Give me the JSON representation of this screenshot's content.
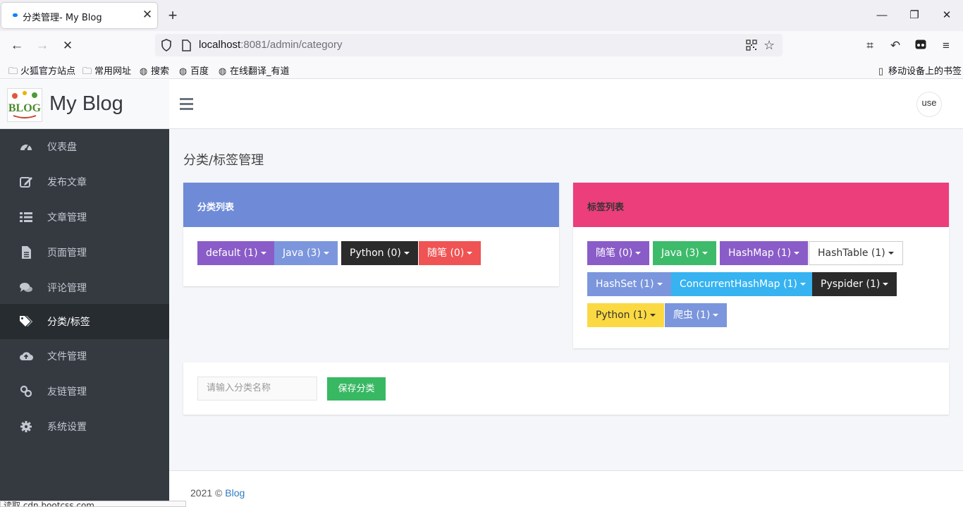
{
  "browser": {
    "tab_title": "分类管理- My Blog",
    "url_host": "localhost",
    "url_rest": ":8081/admin/category",
    "bookmarks": [
      "火狐官方站点",
      "常用网址",
      "搜索",
      "百度",
      "在线翻译_有道"
    ],
    "mobile_bookmarks": "移动设备上的书签",
    "status_text": "读取 cdn.bootcss.com..."
  },
  "brand": {
    "name": "My Blog",
    "logo_text": "BLOG"
  },
  "sidebar": {
    "items": [
      {
        "label": "仪表盘",
        "icon": "dashboard-icon"
      },
      {
        "label": "发布文章",
        "icon": "edit-icon"
      },
      {
        "label": "文章管理",
        "icon": "list-icon"
      },
      {
        "label": "页面管理",
        "icon": "file-icon"
      },
      {
        "label": "评论管理",
        "icon": "comments-icon"
      },
      {
        "label": "分类/标签",
        "icon": "tags-icon",
        "active": true
      },
      {
        "label": "文件管理",
        "icon": "cloud-upload-icon"
      },
      {
        "label": "友链管理",
        "icon": "link-icon"
      },
      {
        "label": "系统设置",
        "icon": "gear-icon"
      }
    ]
  },
  "header": {
    "avatar_text": "use"
  },
  "main": {
    "page_title": "分类/标签管理",
    "categories": {
      "title": "分类列表",
      "header_color": "#6f8bd8",
      "items": [
        {
          "label": "default (1)",
          "color": "#8a5cc8"
        },
        {
          "label": "Java (3)",
          "color": "#7b96dc"
        },
        {
          "label": "Python (0)",
          "color": "#2b2b2b"
        },
        {
          "label": "随笔 (0)",
          "color": "#ef5353"
        }
      ]
    },
    "tags": {
      "title": "标签列表",
      "header_color": "#eb3e7a",
      "items": [
        {
          "label": "随笔 (0)",
          "color": "#8a5cc8"
        },
        {
          "label": "Java (3)",
          "color": "#3dbb6a"
        },
        {
          "label": "HashMap (1)",
          "color": "#8a5cc8"
        },
        {
          "label": "HashTable (1)",
          "color": "#ffffff",
          "text_color": "#333333"
        },
        {
          "label": "HashSet (1)",
          "color": "#7b96dc"
        },
        {
          "label": "ConcurrentHashMap (1)",
          "color": "#36b3f0"
        },
        {
          "label": "Pyspider (1)",
          "color": "#2b2b2b"
        },
        {
          "label": "Python (1)",
          "color": "#fbd943",
          "text_color": "#333333"
        },
        {
          "label": "爬虫 (1)",
          "color": "#7b96dc"
        }
      ]
    },
    "form": {
      "placeholder": "请输入分类名称",
      "save_label": "保存分类"
    }
  },
  "footer": {
    "year_text": "2021 © ",
    "link_text": "Blog"
  }
}
